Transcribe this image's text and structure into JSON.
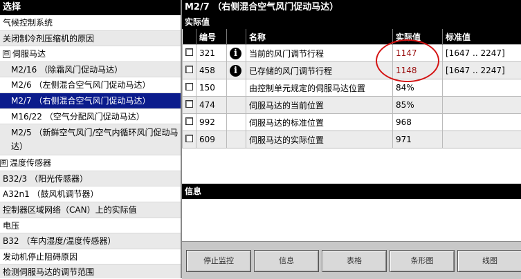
{
  "left": {
    "header": "选择",
    "items": [
      {
        "label": "气候控制系统"
      },
      {
        "label": "关闭制冷剂压缩机的原因"
      },
      {
        "label": "伺服马达",
        "toggle": "⊟"
      },
      {
        "label": "M2/16 （除霜风门促动马达）"
      },
      {
        "label": "M2/6 （左侧混合空气风门促动马达）"
      },
      {
        "label": "M2/7 （右侧混合空气风门促动马达）"
      },
      {
        "label": "M16/22 （空气分配风门促动马达）"
      },
      {
        "label": "M2/5 （新鲜空气风门/空气内循环风门促动马达）"
      },
      {
        "label": "温度传感器",
        "toggle": "⊞"
      },
      {
        "label": "B32/3 （阳光传感器）"
      },
      {
        "label": "A32n1 （鼓风机调节器）"
      },
      {
        "label": "控制器区域网络（CAN）上的实际值"
      },
      {
        "label": "电压"
      },
      {
        "label": "B32 （车内湿度/温度传感器）"
      },
      {
        "label": "发动机停止阻碍原因"
      },
      {
        "label": "检测伺服马达的调节范围"
      }
    ]
  },
  "right": {
    "title": "M2/7 （右侧混合空气风门促动马达）",
    "section": "实际值",
    "columns": [
      "编号",
      "名称",
      "实际值",
      "标准值"
    ],
    "rows": [
      {
        "id": "321",
        "name": "当前的风门调节行程",
        "value": "1147",
        "standard": "[1647 .. 2247]",
        "checkbox": true,
        "info": true
      },
      {
        "id": "458",
        "name": "已存储的风门调节行程",
        "value": "1148",
        "standard": "[1647 .. 2247]",
        "checkbox": true,
        "info": true
      },
      {
        "id": "150",
        "name": "由控制单元规定的伺服马达位置",
        "value": "84%",
        "standard": "",
        "checkbox": true,
        "info": false
      },
      {
        "id": "474",
        "name": "伺服马达的当前位置",
        "value": "85%",
        "standard": "",
        "checkbox": true,
        "info": false
      },
      {
        "id": "992",
        "name": "伺服马达的标准位置",
        "value": "968",
        "standard": "",
        "checkbox": true,
        "info": false
      },
      {
        "id": "609",
        "name": "伺服马达的实际位置",
        "value": "971",
        "standard": "",
        "checkbox": true,
        "info": false
      }
    ],
    "info_label": "信息",
    "info_icon": "i",
    "buttons": [
      "停止监控",
      "信息",
      "表格",
      "条形图",
      "线图"
    ],
    "highlight_color": "#d41414"
  }
}
